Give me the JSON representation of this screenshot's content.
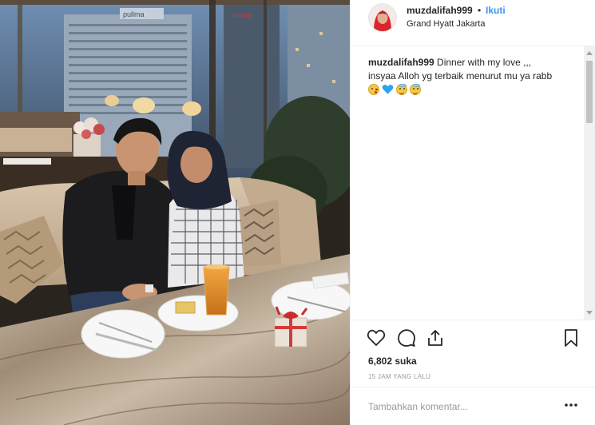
{
  "post": {
    "username": "muzdalifah999",
    "separator": "•",
    "follow_label": "Ikuti",
    "location": "Grand Hyatt Jakarta",
    "caption_user": "muzdalifah999",
    "caption_line1": "Dinner with my love ,,,",
    "caption_line2": "insyaa Alloh yg terbaik menurut mu ya rabb",
    "caption_emojis": [
      "winking-kiss-face",
      "blue-heart",
      "smiling-face-with-halo",
      "smiling-face-with-halo"
    ],
    "likes": "6,802 suka",
    "timestamp": "15 JAM YANG LALU",
    "comment_placeholder": "Tambahkan komentar...",
    "photo_sign_left": "pullma",
    "photo_sign_right": "amaris"
  },
  "icons": {
    "like": "heart-outline-icon",
    "comment": "speech-bubble-icon",
    "share": "share-upload-icon",
    "save": "bookmark-icon",
    "more": "more-options-icon"
  },
  "colors": {
    "link_blue": "#3897f0",
    "text": "#262626",
    "muted": "#999999",
    "border": "#efefef"
  }
}
